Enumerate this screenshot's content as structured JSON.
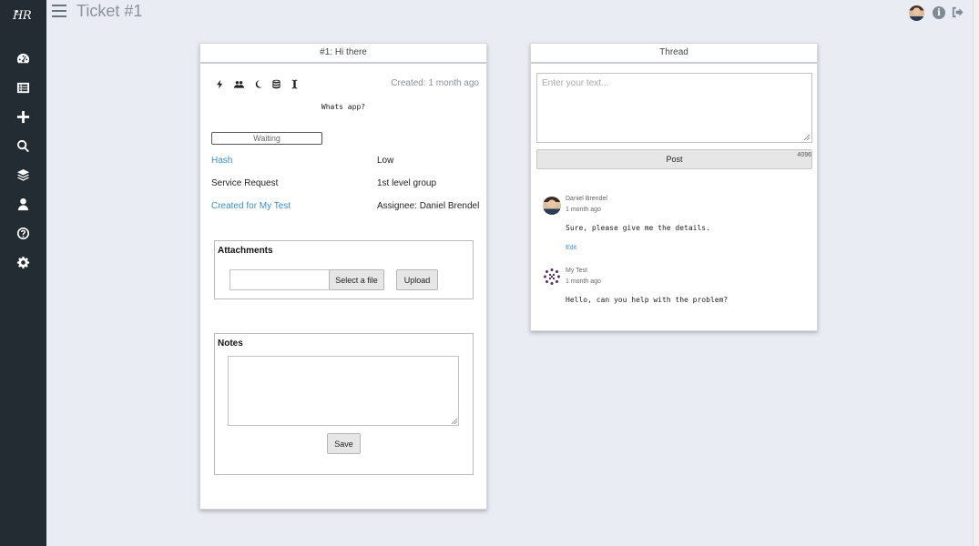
{
  "app": {
    "logo_text": "HR",
    "page_title": "Ticket #1"
  },
  "sidebar": {
    "items": [
      {
        "name": "dashboard-icon"
      },
      {
        "name": "list-icon"
      },
      {
        "name": "plus-icon"
      },
      {
        "name": "search-icon"
      },
      {
        "name": "layers-icon"
      },
      {
        "name": "user-icon"
      },
      {
        "name": "help-icon"
      },
      {
        "name": "gear-icon"
      }
    ]
  },
  "topbar": {
    "info_glyph": "i"
  },
  "ticket": {
    "header": "#1: Hi there",
    "created": "Created: 1 month ago",
    "message": "Whats app?",
    "status": "Waiting",
    "hash_label": "Hash",
    "priority": "Low",
    "type": "Service Request",
    "group": "1st level group",
    "created_for": "Created for My Test",
    "assignee": "Assignee: Daniel Brendel",
    "attachments": {
      "title": "Attachments",
      "select_label": "Select a file",
      "upload_label": "Upload"
    },
    "notes": {
      "title": "Notes",
      "save_label": "Save"
    }
  },
  "thread": {
    "header": "Thread",
    "placeholder": "Enter your text...",
    "post_label": "Post",
    "char_count": "4096",
    "messages": [
      {
        "author": "Daniel Brendel",
        "time": "1 month ago",
        "text": "Sure, please give me the details.",
        "edit_label": "Edit"
      },
      {
        "author": "My Test",
        "time": "1 month ago",
        "text": "Hello, can you help with the problem?"
      }
    ]
  },
  "colors": {
    "sidebar": "#232b33",
    "link": "#3b8fd1",
    "background": "#e9ecf3"
  }
}
